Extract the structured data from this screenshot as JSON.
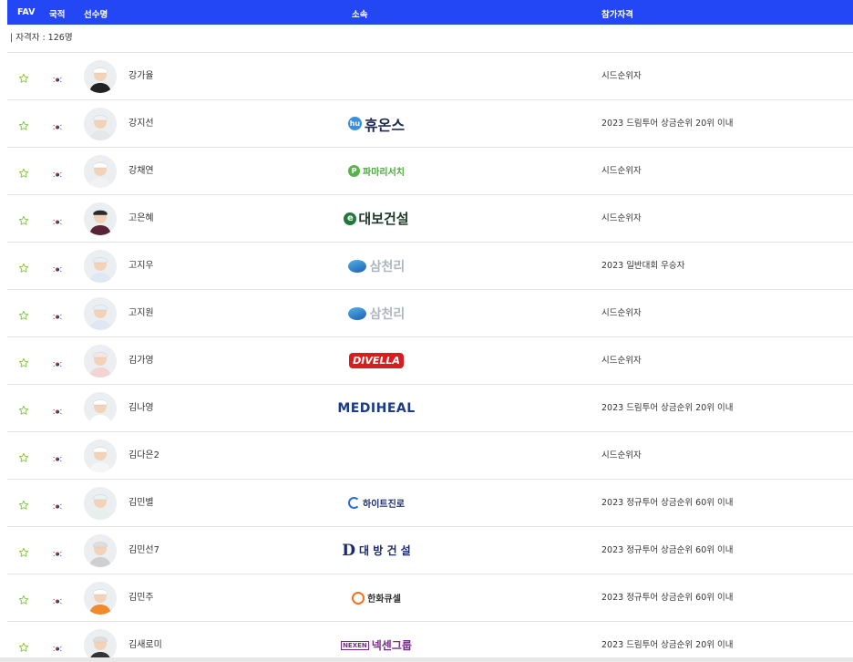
{
  "table": {
    "headers": {
      "fav": "FAV",
      "nation": "국적",
      "name": "선수명",
      "affiliation": "소속",
      "qualification": "참가자격"
    },
    "count_label": "| 자격자 : 126명",
    "rows": [
      {
        "name": "강가율",
        "affiliation": "",
        "qualification": "시드순위자",
        "logo": "none"
      },
      {
        "name": "강지선",
        "affiliation": "휴온스",
        "qualification": "2023 드림투어 상금순위 20위 이내",
        "logo": "huons"
      },
      {
        "name": "강채연",
        "affiliation": "파마리서치",
        "qualification": "시드순위자",
        "logo": "pharmaresearch"
      },
      {
        "name": "고은혜",
        "affiliation": "대보건설",
        "qualification": "시드순위자",
        "logo": "daebo"
      },
      {
        "name": "고지우",
        "affiliation": "삼천리",
        "qualification": "2023 일반대회 우승자",
        "logo": "samchully"
      },
      {
        "name": "고지원",
        "affiliation": "삼천리",
        "qualification": "시드순위자",
        "logo": "samchully"
      },
      {
        "name": "김가영",
        "affiliation": "DIVELLA",
        "qualification": "시드순위자",
        "logo": "divella"
      },
      {
        "name": "김나영",
        "affiliation": "MEDIHEAL",
        "qualification": "2023 드림투어 상금순위 20위 이내",
        "logo": "mediheal"
      },
      {
        "name": "김다은2",
        "affiliation": "",
        "qualification": "시드순위자",
        "logo": "none"
      },
      {
        "name": "김민별",
        "affiliation": "하이트진로",
        "qualification": "2023 정규투어 상금순위 60위 이내",
        "logo": "hite"
      },
      {
        "name": "김민선7",
        "affiliation": "대 방 건 설",
        "qualification": "2023 정규투어 상금순위 60위 이내",
        "logo": "daebang"
      },
      {
        "name": "김민주",
        "affiliation": "한화큐셀",
        "qualification": "2023 정규투어 상금순위 60위 이내",
        "logo": "hanwha"
      },
      {
        "name": "김새로미",
        "affiliation": "넥센그룹",
        "qualification": "2023 드림투어 상금순위 20위 이내",
        "logo": "nexen"
      }
    ]
  },
  "icons": {
    "fav": "star-outline-icon",
    "nation": "korea-flag-icon",
    "avatar": "player-photo"
  },
  "colors": {
    "header_bg": "#2447f5",
    "star": "#7ec542",
    "divider": "#e4e4e4"
  }
}
